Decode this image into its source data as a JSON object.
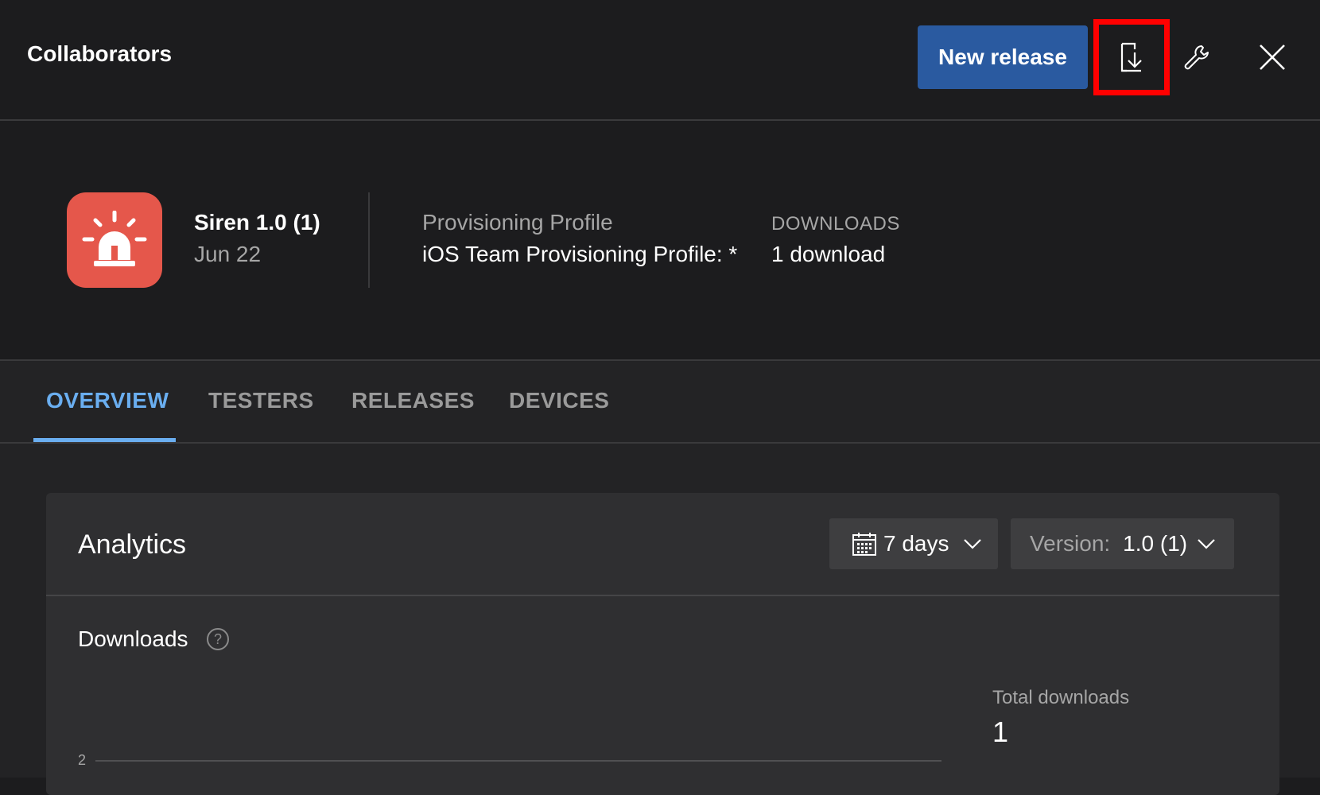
{
  "header": {
    "title": "Collaborators",
    "new_release_label": "New release",
    "icons": [
      "download-to-device-icon",
      "wrench-icon",
      "close-icon"
    ]
  },
  "app": {
    "name": "Siren 1.0 (1)",
    "date": "Jun 22",
    "icon": "siren-icon",
    "icon_color": "#e5574b",
    "provisioning_label": "Provisioning Profile",
    "provisioning_value": "iOS Team Provisioning Profile: *",
    "downloads_label": "DOWNLOADS",
    "downloads_value": "1 download"
  },
  "tabs": [
    {
      "label": "OVERVIEW",
      "active": true
    },
    {
      "label": "TESTERS",
      "active": false
    },
    {
      "label": "RELEASES",
      "active": false
    },
    {
      "label": "DEVICES",
      "active": false
    }
  ],
  "analytics": {
    "title": "Analytics",
    "range_value": "7 days",
    "version_label": "Version:",
    "version_value": "1.0 (1)",
    "downloads_title": "Downloads",
    "help_glyph": "?",
    "total_label": "Total downloads",
    "total_value": "1",
    "y_tick_top": "2"
  },
  "colors": {
    "accent": "#6aaef0",
    "primary_button": "#2a5aa0",
    "highlight": "#ff0000"
  }
}
